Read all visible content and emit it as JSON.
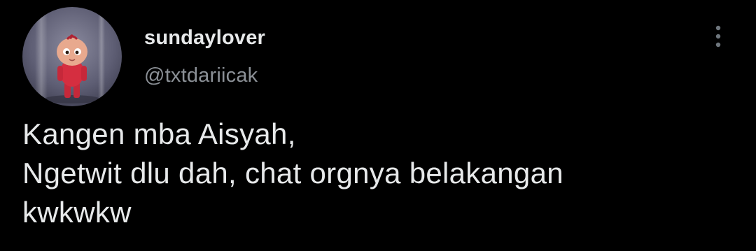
{
  "tweet": {
    "author": {
      "display_name": "sundaylover",
      "handle": "@txtdariicak"
    },
    "text_lines": [
      "Kangen mba Aisyah,",
      "Ngetwit dlu dah, chat orgnya belakangan",
      "kwkwkw"
    ],
    "more_icon": "more-vertical-icon"
  },
  "colors": {
    "background": "#000000",
    "text_primary": "#e7e9ea",
    "text_secondary": "#8b9096"
  }
}
